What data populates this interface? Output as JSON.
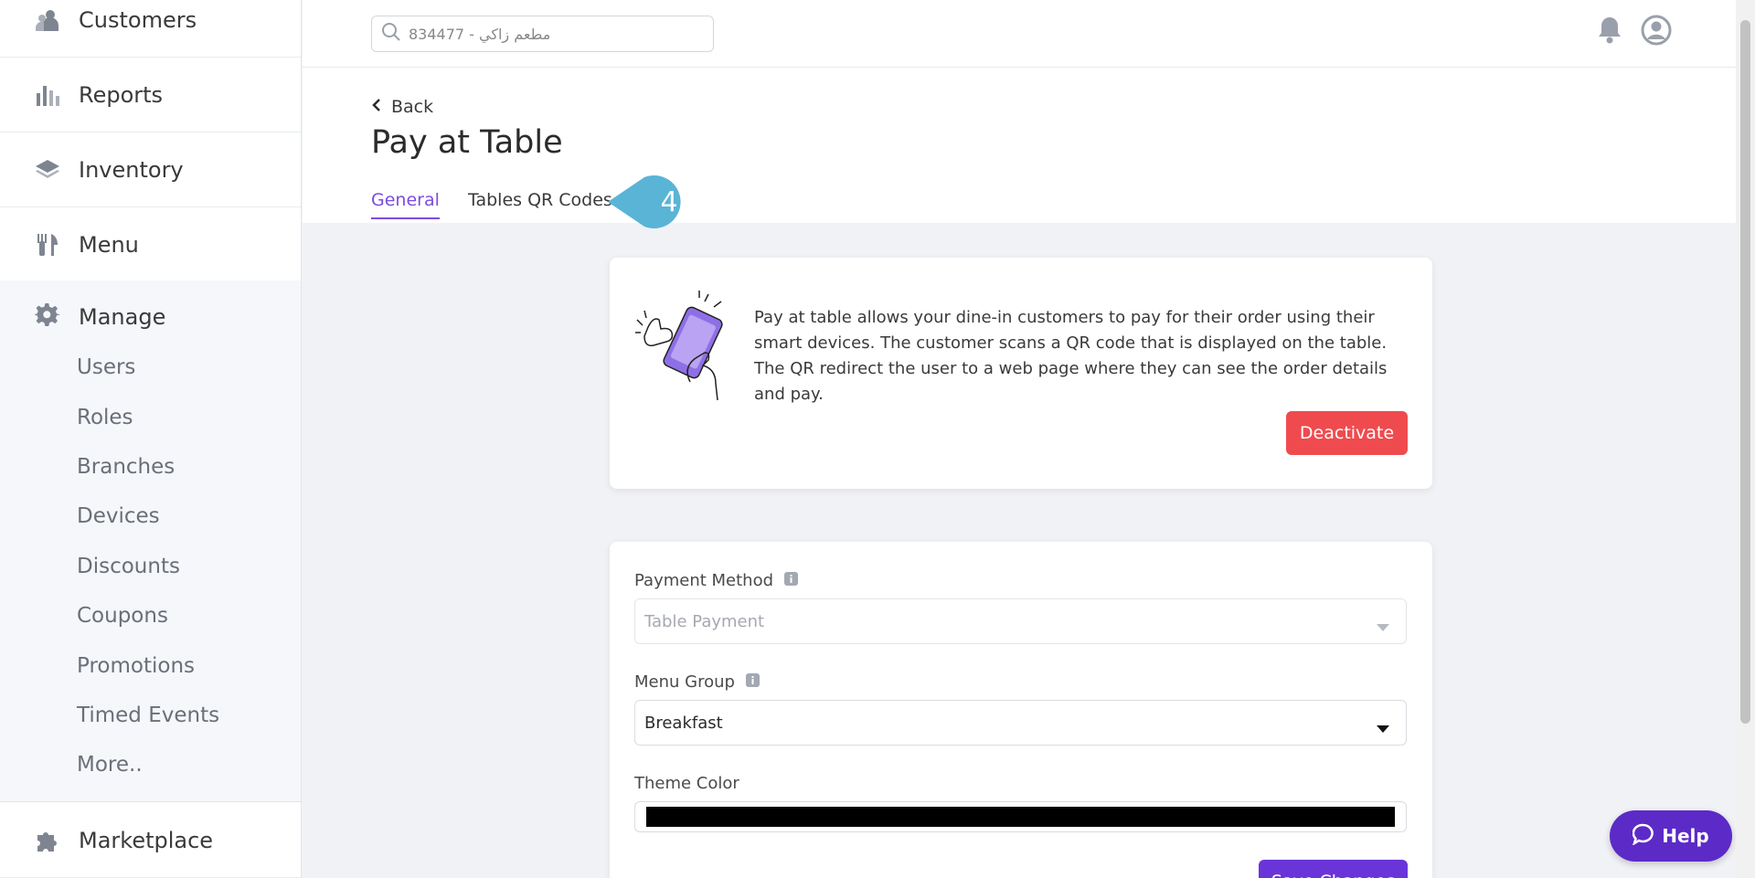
{
  "sidebar": {
    "items": [
      {
        "label": "Customers",
        "icon": "customers-icon"
      },
      {
        "label": "Reports",
        "icon": "reports-icon"
      },
      {
        "label": "Inventory",
        "icon": "inventory-icon"
      },
      {
        "label": "Menu",
        "icon": "menu-icon"
      }
    ],
    "manage": {
      "label": "Manage",
      "icon": "gear-icon",
      "sub_items": [
        "Users",
        "Roles",
        "Branches",
        "Devices",
        "Discounts",
        "Coupons",
        "Promotions",
        "Timed Events",
        "More.."
      ]
    },
    "marketplace": {
      "label": "Marketplace",
      "icon": "puzzle-icon"
    }
  },
  "topbar": {
    "search_value": "مطعم زاكي - 834477"
  },
  "header": {
    "back_label": "Back",
    "title": "Pay at Table",
    "tabs": [
      {
        "label": "General",
        "active": true
      },
      {
        "label": "Tables QR Codes",
        "active": false
      }
    ],
    "callout_number": "4"
  },
  "info_card": {
    "description": "Pay at table allows your dine-in customers to pay for their order using their smart devices. The customer scans a QR code that is displayed on the table. The QR redirect the user to a web page where they can see the order details and pay.",
    "deactivate_label": "Deactivate"
  },
  "form": {
    "payment_method": {
      "label": "Payment Method",
      "value": "Table Payment"
    },
    "menu_group": {
      "label": "Menu Group",
      "value": "Breakfast"
    },
    "theme_color": {
      "label": "Theme Color",
      "value": "#000000"
    },
    "save_label": "Save Changes"
  },
  "help": {
    "label": "Help"
  },
  "colors": {
    "accent": "#7b4ce0",
    "danger": "#ef4b4f",
    "primary_button": "#6a35d8",
    "callout": "#5ab4d6"
  }
}
